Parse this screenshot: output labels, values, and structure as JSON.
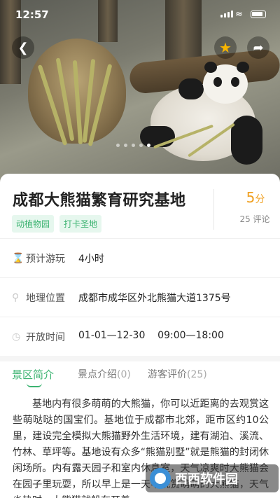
{
  "status": {
    "time": "12:57"
  },
  "hero": {
    "back_icon": "chevron-left-icon",
    "fav_icon": "star-icon",
    "share_icon": "share-icon",
    "fav_color": "#f7b500"
  },
  "place": {
    "title": "成都大熊猫繁育研究基地",
    "tags": [
      "动植物园",
      "打卡圣地"
    ],
    "score": "5",
    "score_unit": "分",
    "reviews": "25 评论"
  },
  "info": {
    "duration_label": "预计游玩",
    "duration_value": "4小时",
    "location_label": "地理位置",
    "location_value": "成都市成华区外北熊猫大道1375号",
    "hours_label": "开放时间",
    "hours_value": "01-01—12-30    09:00—18:00"
  },
  "tabs": [
    {
      "label": "景区简介",
      "count": ""
    },
    {
      "label": "景点介绍",
      "count": "(0)"
    },
    {
      "label": "游客评价",
      "count": "(25)"
    }
  ],
  "description": "基地内有很多萌萌的大熊猫，你可以近距离的去观赏这些萌哒哒的国宝们。基地位于成都市北郊，距市区约10公里，建设完全模拟大熊猫野外生活环境，建有湖泊、溪流、竹林、草坪等。基地设有众多“熊猫别墅”就是熊猫的封闭休闲场所。内有露天园子和室内休息室，天气凉爽时大熊猫会在园子里玩耍，所以早上是一天中观赏萌萌的大熊猫，天气炎热时，大熊猫就躲在开着",
  "watermark": {
    "text": "西西软件园"
  },
  "accent": "#3cb371"
}
